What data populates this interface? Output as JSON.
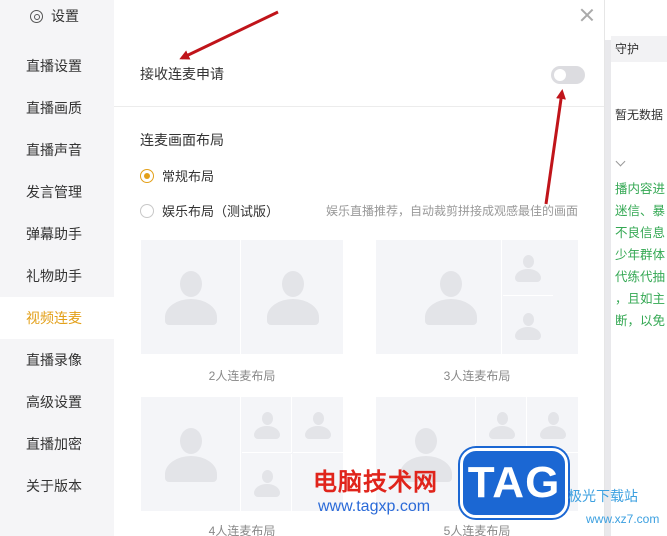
{
  "sidebar": {
    "title": "设置",
    "items": [
      {
        "label": "直播设置"
      },
      {
        "label": "直播画质"
      },
      {
        "label": "直播声音"
      },
      {
        "label": "发言管理"
      },
      {
        "label": "弹幕助手"
      },
      {
        "label": "礼物助手"
      },
      {
        "label": "视频连麦",
        "active": true
      },
      {
        "label": "直播录像"
      },
      {
        "label": "高级设置"
      },
      {
        "label": "直播加密"
      },
      {
        "label": "关于版本"
      }
    ]
  },
  "panel": {
    "accept_label": "接收连麦申请",
    "accept_enabled": false,
    "layout_section_title": "连麦画面布局",
    "radio_normal": "常规布局",
    "radio_normal_checked": true,
    "radio_entertainment": "娱乐布局（测试版）",
    "radio_entertainment_checked": false,
    "entertainment_hint": "娱乐直播推荐，自动裁剪拼接成观感最佳的画面",
    "layouts": [
      {
        "label": "2人连麦布局"
      },
      {
        "label": "3人连麦布局"
      },
      {
        "label": "4人连麦布局"
      },
      {
        "label": "5人连麦布局"
      }
    ]
  },
  "background_panel": {
    "header_partial": "守护",
    "empty_text": "暂无数据",
    "notice_lines": [
      "播内容进",
      "迷信、暴",
      "不良信息",
      "少年群体",
      "代练代抽",
      "，且如主",
      "断，以免"
    ]
  },
  "watermark": {
    "brand_cn": "电脑技术网",
    "brand_url": "www.tagxp.com",
    "logo_text": "TAG",
    "site_cn": "极光下载站",
    "site_domain": "www.xz7.com"
  },
  "colors": {
    "accent": "#e3a019",
    "sidebar_bg": "#f5f5f7",
    "notice_green": "#34a853",
    "arrow_red": "#c0141a",
    "watermark_red": "#e0241b",
    "watermark_blue": "#1b67d3"
  }
}
